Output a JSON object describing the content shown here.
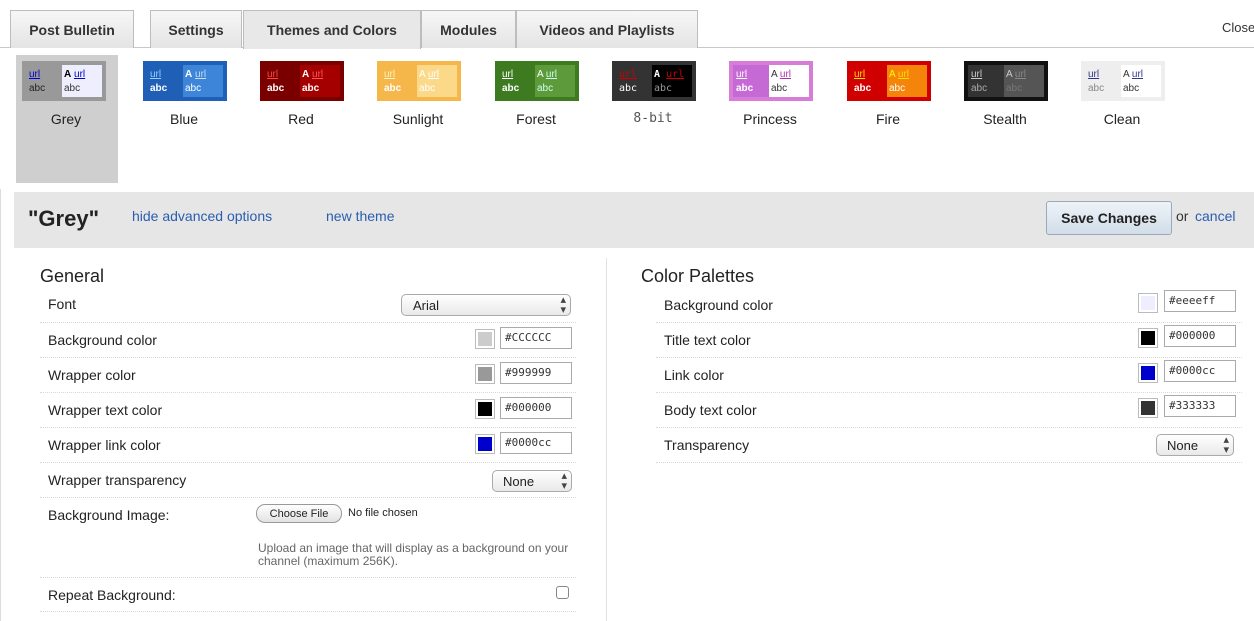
{
  "tabs": [
    "Post Bulletin",
    "Settings",
    "Themes and Colors",
    "Modules",
    "Videos and Playlists"
  ],
  "close_label": "Close",
  "themes": [
    {
      "name": "Grey",
      "l1": "url",
      "l2": "abc",
      "r1": "A",
      "r2": "url",
      "r3": "abc"
    },
    {
      "name": "Blue",
      "l1": "url",
      "l2": "abc",
      "r1": "A",
      "r2": "url",
      "r3": "abc"
    },
    {
      "name": "Red",
      "l1": "url",
      "l2": "abc",
      "r1": "A",
      "r2": "url",
      "r3": "abc"
    },
    {
      "name": "Sunlight",
      "l1": "url",
      "l2": "abc",
      "r1": "A",
      "r2": "url",
      "r3": "abc"
    },
    {
      "name": "Forest",
      "l1": "url",
      "l2": "abc",
      "r1": "A",
      "r2": "url",
      "r3": "abc"
    },
    {
      "name": "8-bit",
      "l1": "url",
      "l2": "abc",
      "r1": "A",
      "r2": "url",
      "r3": "abc"
    },
    {
      "name": "Princess",
      "l1": "url",
      "l2": "abc",
      "r1": "A",
      "r2": "url",
      "r3": "abc"
    },
    {
      "name": "Fire",
      "l1": "url",
      "l2": "abc",
      "r1": "A",
      "r2": "url",
      "r3": "abc"
    },
    {
      "name": "Stealth",
      "l1": "url",
      "l2": "abc",
      "r1": "A",
      "r2": "url",
      "r3": "abc"
    },
    {
      "name": "Clean",
      "l1": "url",
      "l2": "abc",
      "r1": "A",
      "r2": "url",
      "r3": "abc"
    }
  ],
  "header": {
    "title": "\"Grey\"",
    "hide_advanced": "hide advanced options",
    "new_theme": "new theme",
    "save": "Save Changes",
    "or": "or",
    "cancel": "cancel"
  },
  "general": {
    "title": "General",
    "font_label": "Font",
    "font_value": "Arial",
    "bg_color_label": "Background color",
    "bg_color_value": "#CCCCCC",
    "wrapper_color_label": "Wrapper color",
    "wrapper_color_value": "#999999",
    "wrapper_text_label": "Wrapper text color",
    "wrapper_text_value": "#000000",
    "wrapper_link_label": "Wrapper link color",
    "wrapper_link_value": "#0000cc",
    "wrapper_transparency_label": "Wrapper transparency",
    "wrapper_transparency_value": "None",
    "bg_image_label": "Background Image:",
    "choose_file": "Choose File",
    "no_file": "No file chosen",
    "upload_help": "Upload an image that will display as a background on your channel (maximum 256K).",
    "repeat_bg_label": "Repeat Background:"
  },
  "palettes": {
    "title": "Color Palettes",
    "bg_label": "Background color",
    "bg_value": "#eeeeff",
    "title_text_label": "Title text color",
    "title_text_value": "#000000",
    "link_label": "Link color",
    "link_value": "#0000cc",
    "body_text_label": "Body text color",
    "body_text_value": "#333333",
    "transparency_label": "Transparency",
    "transparency_value": "None"
  },
  "colors": {
    "link": "#2a5db0",
    "swatch_grey": "#cccccc",
    "swatch_wrapper": "#999999",
    "swatch_black": "#000000",
    "swatch_blue": "#0000cc",
    "swatch_bg": "#eeeeff",
    "swatch_body": "#333333"
  }
}
